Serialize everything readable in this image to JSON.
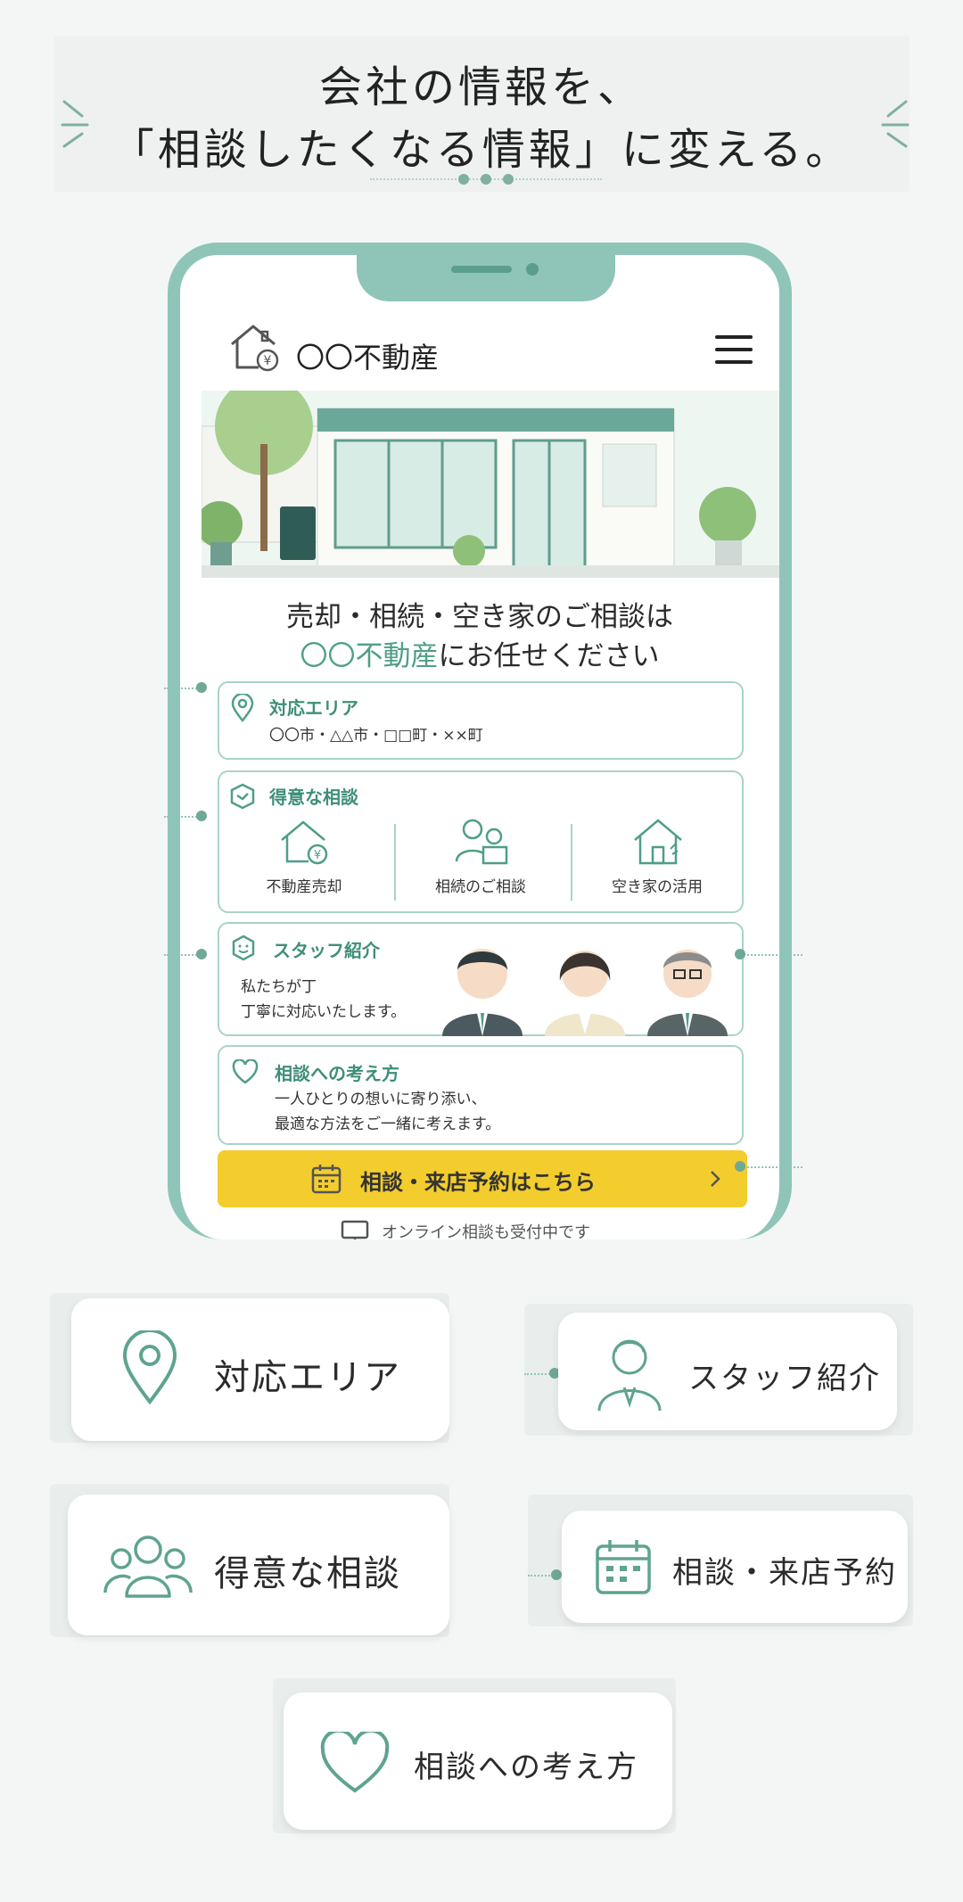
{
  "headline": {
    "line1": "会社の情報を、",
    "line2": "「相談したくなる情報」に変える。"
  },
  "phone": {
    "brand": "〇〇不動産",
    "tagline_line1": "売却・相続・空き家のご相談は",
    "tagline_line2_accent": "〇〇不動産",
    "tagline_line2_rest": "にお任せください",
    "area": {
      "title": "対応エリア",
      "text": "〇〇市・△△市・□□町・××町"
    },
    "specialties": {
      "title": "得意な相談",
      "items": [
        {
          "label": "不動産売却",
          "icon": "house-yen-icon"
        },
        {
          "label": "相続のご相談",
          "icon": "family-icon"
        },
        {
          "label": "空き家の活用",
          "icon": "empty-house-icon"
        }
      ]
    },
    "staff": {
      "title": "スタッフ紹介",
      "text_line1": "私たちが丁",
      "text_line2": "丁寧に対応いたします。"
    },
    "philosophy": {
      "title": "相談への考え方",
      "text_line1": "一人ひとりの想いに寄り添い、",
      "text_line2": "最適な方法をご一緒に考えます。"
    },
    "cta": {
      "label": "相談・来店予約はこちら",
      "icon": "calendar-icon"
    },
    "online_note": "オンライン相談も受付中です"
  },
  "chips": [
    {
      "label": "対応エリア",
      "icon": "map-pin-icon"
    },
    {
      "label": "スタッフ紹介",
      "icon": "staff-person-icon"
    },
    {
      "label": "得意な相談",
      "icon": "people-icon"
    },
    {
      "label": "相談・来店予約",
      "icon": "calendar-icon"
    },
    {
      "label": "相談への考え方",
      "icon": "heart-icon"
    }
  ],
  "colors": {
    "accent": "#4f9e89",
    "frame": "#8ec5b8",
    "cta": "#f3cd2d"
  }
}
